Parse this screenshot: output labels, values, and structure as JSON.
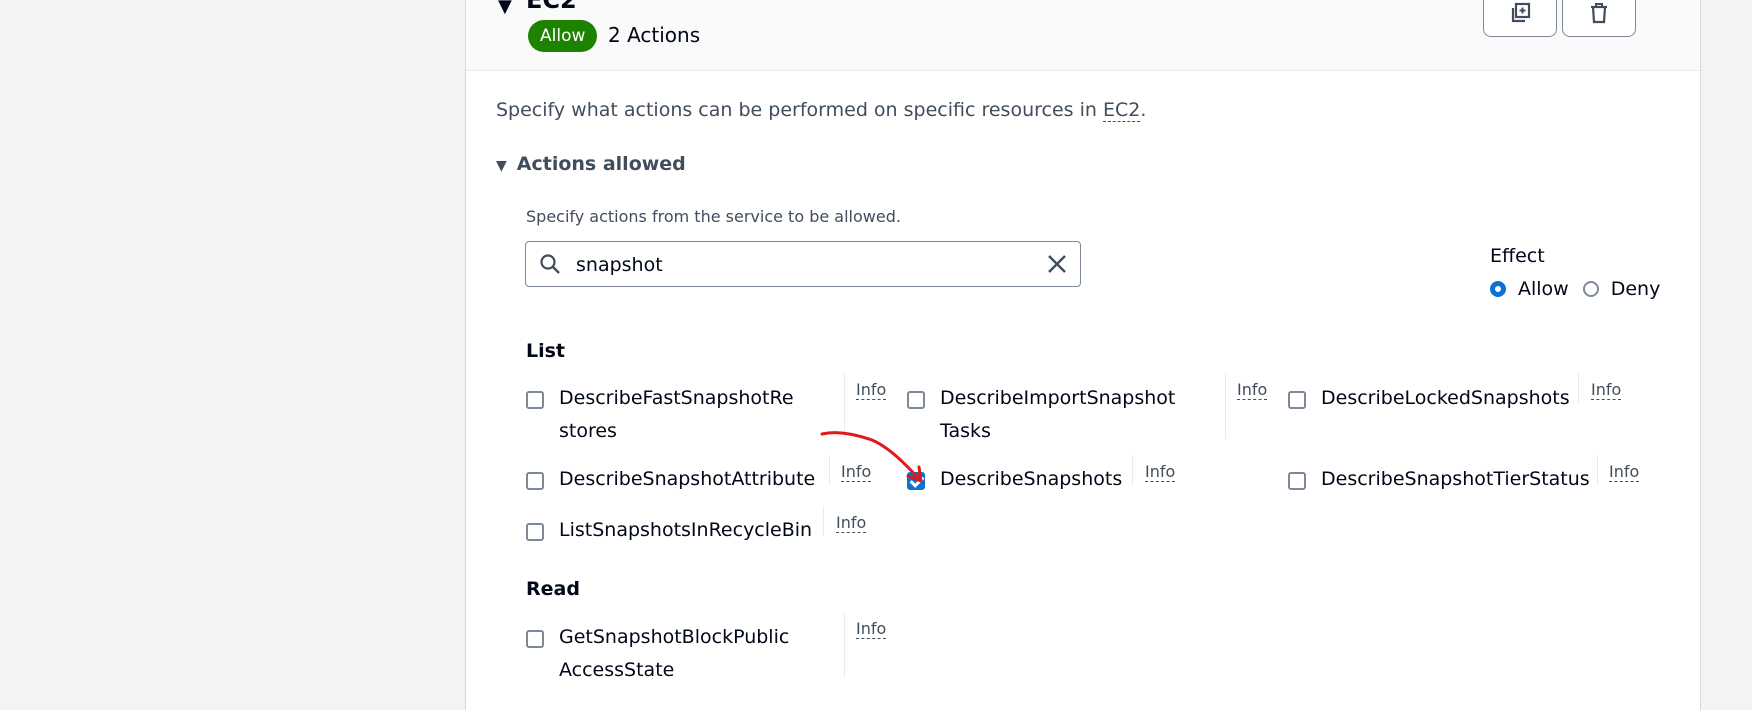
{
  "service": {
    "name": "EC2",
    "badge": "Allow",
    "actions_count": "2 Actions",
    "description_prefix": "Specify what actions can be performed on specific resources in ",
    "description_service": "EC2",
    "description_suffix": "."
  },
  "header_buttons": {
    "duplicate_icon": "duplicate-icon",
    "delete_icon": "trash-icon"
  },
  "actions_allowed": {
    "title": "Actions allowed",
    "hint": "Specify actions from the service to be allowed.",
    "search_value": "snapshot"
  },
  "effect": {
    "label": "Effect",
    "options": [
      "Allow",
      "Deny"
    ],
    "selected": "Allow"
  },
  "groups": [
    {
      "title": "List",
      "actions": [
        {
          "name": "DescribeFastSnapshotRestores",
          "checked": false,
          "info": "Info"
        },
        {
          "name": "DescribeImportSnapshotTasks",
          "checked": false,
          "info": "Info"
        },
        {
          "name": "DescribeLockedSnapshots",
          "checked": false,
          "info": "Info"
        },
        {
          "name": "DescribeSnapshotAttribute",
          "checked": false,
          "info": "Info"
        },
        {
          "name": "DescribeSnapshots",
          "checked": true,
          "info": "Info"
        },
        {
          "name": "DescribeSnapshotTierStatus",
          "checked": false,
          "info": "Info"
        },
        {
          "name": "ListSnapshotsInRecycleBin",
          "checked": false,
          "info": "Info"
        }
      ]
    },
    {
      "title": "Read",
      "actions": [
        {
          "name": "GetSnapshotBlockPublicAccessState",
          "checked": false,
          "info": "Info"
        }
      ]
    }
  ],
  "colors": {
    "allow_green": "#1d8102",
    "accent_blue": "#0972d3",
    "annotation_red": "#e0191b"
  }
}
